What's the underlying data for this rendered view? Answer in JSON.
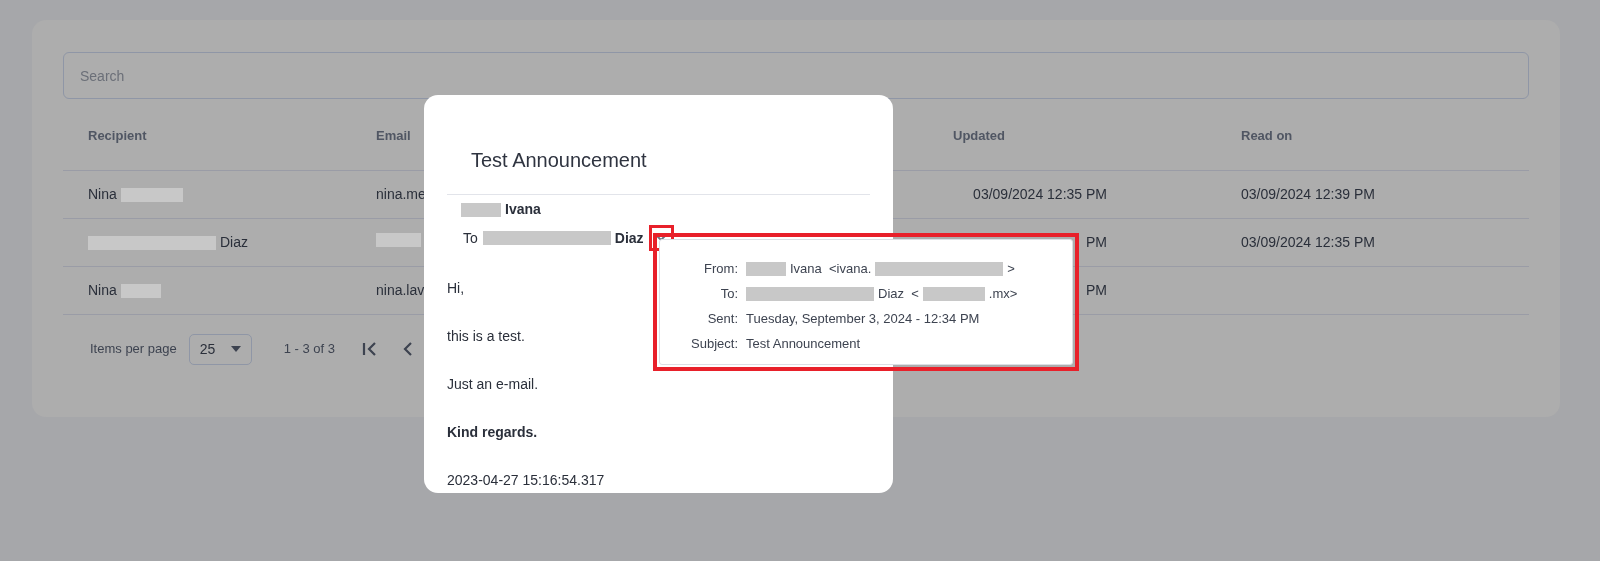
{
  "search": {
    "placeholder": "Search"
  },
  "table": {
    "columns": [
      "Recipient",
      "Email",
      "",
      "Updated",
      "Read on"
    ],
    "rows": [
      {
        "recipient": [
          {
            "kind": "text",
            "text": "Nina"
          },
          {
            "kind": "redacted_medium"
          }
        ],
        "email": "nina.me",
        "updated": "03/09/2024 12:35 PM",
        "read_on": "03/09/2024 12:39 PM"
      },
      {
        "recipient": [
          {
            "kind": "redacted_long"
          },
          {
            "kind": "text",
            "text": "Diaz"
          }
        ],
        "email": "",
        "updated": "PM",
        "read_on": "03/09/2024 12:35 PM"
      },
      {
        "recipient": [
          {
            "kind": "text",
            "text": "Nina"
          },
          {
            "kind": "redacted_short"
          }
        ],
        "email": "nina.lav",
        "updated": "PM",
        "read_on": ""
      }
    ]
  },
  "pagination": {
    "label": "Items per page",
    "page_size": "25",
    "range": "1 - 3 of 3"
  },
  "modal": {
    "title": "Test Announcement",
    "from": [
      {
        "kind": "redacted_short"
      },
      {
        "kind": "text",
        "text": "Ivana"
      }
    ],
    "to_label": "To",
    "to": [
      {
        "kind": "redacted_long"
      },
      {
        "kind": "text",
        "text": "Diaz"
      }
    ],
    "body": [
      {
        "text": "Hi,",
        "bold": false
      },
      {
        "text": "this is a test.",
        "bold": false
      },
      {
        "text": "Just an e-mail.",
        "bold": false
      },
      {
        "text": "Kind regards.",
        "bold": true
      },
      {
        "text": "2023-04-27 15:16:54.317",
        "bold": false
      }
    ]
  },
  "details": [
    {
      "label": "From:",
      "value": [
        {
          "kind": "redacted_short"
        },
        {
          "kind": "text",
          "text": "Ivana  <ivana."
        },
        {
          "kind": "redacted_long"
        },
        {
          "kind": "text",
          "text": ">"
        }
      ]
    },
    {
      "label": "To:",
      "value": [
        {
          "kind": "redacted_long"
        },
        {
          "kind": "text",
          "text": "Diaz  <"
        },
        {
          "kind": "redacted_medium"
        },
        {
          "kind": "text",
          "text": ".mx>"
        }
      ]
    },
    {
      "label": "Sent:",
      "value": [
        {
          "kind": "text",
          "text": "Tuesday, September 3, 2024 - 12:34 PM"
        }
      ]
    },
    {
      "label": "Subject:",
      "value": [
        {
          "kind": "text",
          "text": "Test Announcement"
        }
      ]
    }
  ]
}
